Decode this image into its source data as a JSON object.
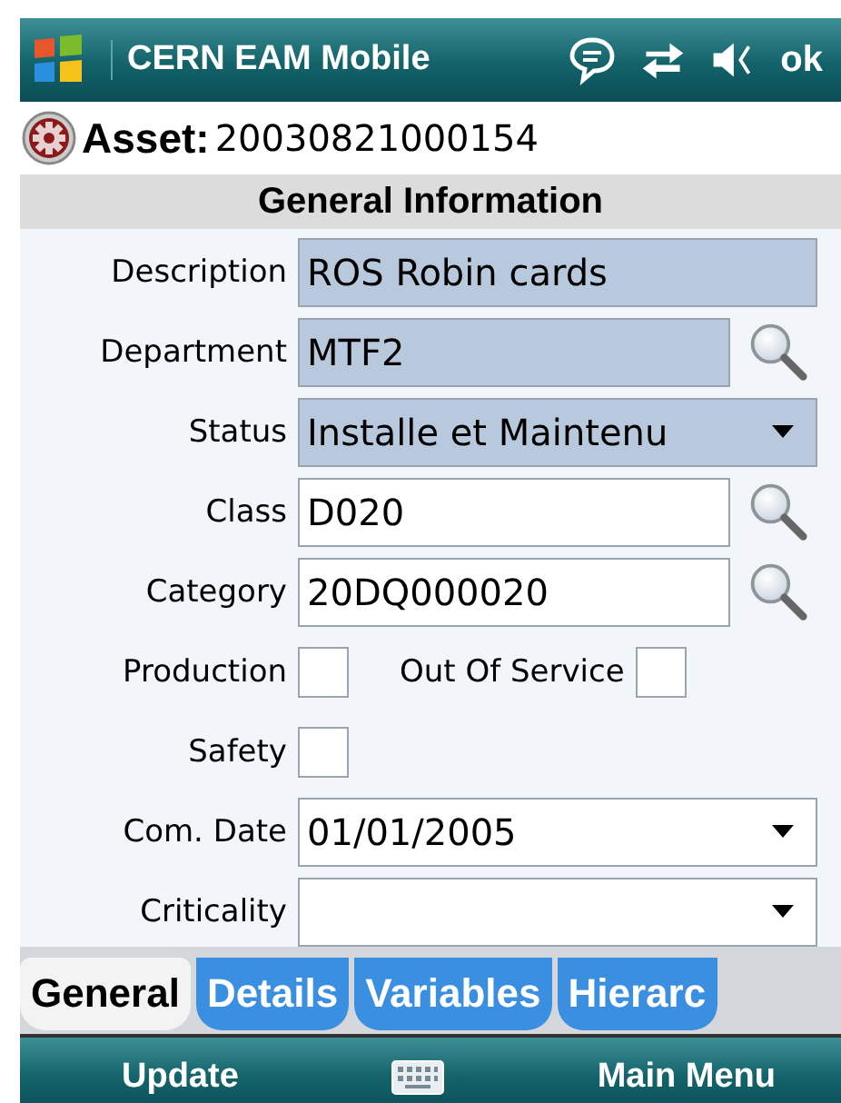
{
  "title_bar": {
    "title": "CERN EAM Mobile",
    "ok": "ok"
  },
  "record": {
    "label": "Asset:",
    "value": "20030821000154"
  },
  "section": {
    "title": "General Information"
  },
  "fields": [
    {
      "kind": "text",
      "label": "Description",
      "value": "ROS Robin cards",
      "editable": false
    },
    {
      "kind": "lookup",
      "label": "Department",
      "value": "MTF2",
      "editable": false
    },
    {
      "kind": "dropdown",
      "label": "Status",
      "value": "Installe et Maintenu",
      "editable": false
    },
    {
      "kind": "lookup",
      "label": "Class",
      "value": "D020",
      "editable": true
    },
    {
      "kind": "lookup",
      "label": "Category",
      "value": "20DQ000020",
      "editable": true
    },
    {
      "kind": "checkboxes",
      "items": [
        {
          "label": "Production",
          "checked": false
        },
        {
          "label": "Out Of Service",
          "checked": false
        }
      ]
    },
    {
      "kind": "checkboxes",
      "items": [
        {
          "label": "Safety",
          "checked": false
        }
      ]
    },
    {
      "kind": "dropdown",
      "label": "Com. Date",
      "value": "01/01/2005",
      "editable": true
    },
    {
      "kind": "dropdown",
      "label": "Criticality",
      "editable": true
    }
  ],
  "tabs": [
    {
      "label": "General",
      "selected": true
    },
    {
      "label": "Details",
      "selected": false
    },
    {
      "label": "Variables",
      "selected": false
    },
    {
      "label": "Hierarc",
      "selected": false
    }
  ],
  "softkeys": {
    "left": "Update",
    "right": "Main Menu"
  }
}
